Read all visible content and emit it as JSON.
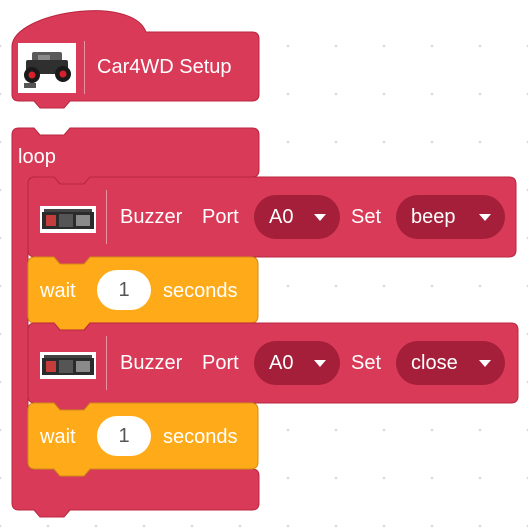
{
  "setup_block": {
    "label": "Car4WD Setup",
    "icon": "car-4wd-icon"
  },
  "loop_block": {
    "label": "loop"
  },
  "blocks": [
    {
      "type": "buzzer",
      "label": "Buzzer",
      "port_label": "Port",
      "port_value": "A0",
      "set_label": "Set",
      "set_value": "beep",
      "icon": "buzzer-module-icon"
    },
    {
      "type": "wait",
      "label": "wait",
      "value": "1",
      "unit": "seconds"
    },
    {
      "type": "buzzer",
      "label": "Buzzer",
      "port_label": "Port",
      "port_value": "A0",
      "set_label": "Set",
      "set_value": "close",
      "icon": "buzzer-module-icon"
    },
    {
      "type": "wait",
      "label": "wait",
      "value": "1",
      "unit": "seconds"
    }
  ],
  "colors": {
    "block_primary": "#d83a58",
    "block_dark": "#a51f3a",
    "block_border": "#b8263f",
    "wait_block": "#ffab19",
    "wait_border": "#cf8b17",
    "background": "#ffffff"
  }
}
